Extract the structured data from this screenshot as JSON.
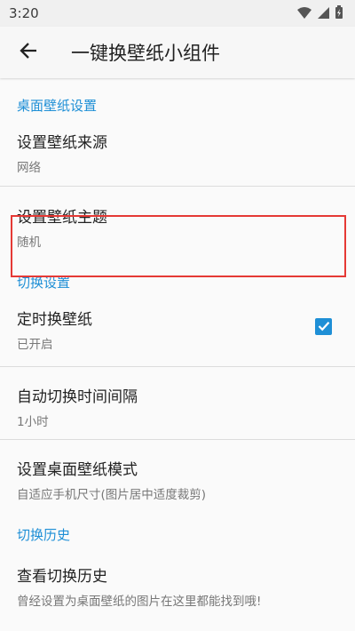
{
  "status_bar": {
    "time": "3:20"
  },
  "app_bar": {
    "title": "一键换壁纸小组件"
  },
  "sections": {
    "wallpaper": {
      "header": "桌面壁纸设置"
    },
    "switch": {
      "header": "切换设置"
    },
    "history": {
      "header": "切换历史"
    }
  },
  "items": {
    "source": {
      "title": "设置壁纸来源",
      "summary": "网络"
    },
    "theme": {
      "title": "设置壁纸主题",
      "summary": "随机"
    },
    "timed": {
      "title": "定时换壁纸",
      "summary": "已开启",
      "checked": true
    },
    "interval": {
      "title": "自动切换时间间隔",
      "summary": "1小时"
    },
    "mode": {
      "title": "设置桌面壁纸模式",
      "summary": "自适应手机尺寸(图片居中适度裁剪)"
    },
    "history": {
      "title": "查看切换历史",
      "summary": "曾经设置为桌面壁纸的图片在这里都能找到哦!"
    }
  },
  "colors": {
    "accent": "#1e8fd6",
    "highlight": "#e53935"
  }
}
